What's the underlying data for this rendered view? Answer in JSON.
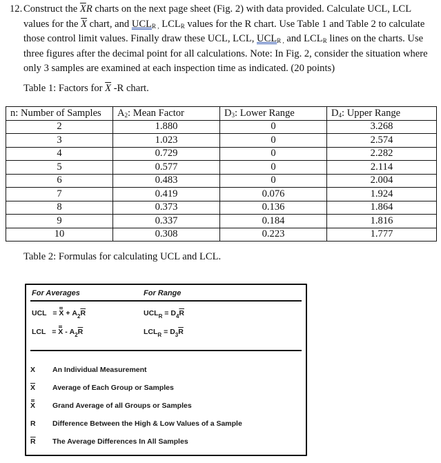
{
  "question": {
    "number": "12.",
    "line1_a": "Construct the ",
    "line1_xbar": "X",
    "line1_r": "R",
    "line1_b": "  charts on the next page sheet (Fig. 2) with data provided. Calculate UCL, LCL",
    "line2_a": "values for the ",
    "line2_xbar": "X",
    "line2_b": " chart, and ",
    "line2_uclr": "UCL",
    "line2_uclr_sub": "R ,",
    "line2_c": " LCL",
    "line2_lclr_sub": "R",
    "line2_d": " values for the R chart. Use Table 1 and Table 2 to calculate",
    "line3_a": "those control limit values. Finally draw these UCL, LCL, ",
    "line3_uclr": "UCL",
    "line3_uclr_sub": "R ,",
    "line3_b": " and LCL",
    "line3_lclr_sub": "R",
    "line3_c": " lines on the charts. Use",
    "line4": "three figures after the decimal point for all calculations. Note: In Fig. 2, consider the situation where",
    "line5": "only 3 samples are examined at each inspection time as indicated.   (20 points)"
  },
  "table1": {
    "caption_a": "Table 1: Factors for ",
    "caption_xbar": "X",
    "caption_b": " -R chart.",
    "headers": [
      {
        "main": "n: Number of Samples",
        "sub": "",
        "rest": ""
      },
      {
        "main": "A",
        "sub": "2",
        "rest": ": Mean Factor"
      },
      {
        "main": "D",
        "sub": "3",
        "rest": ": Lower Range"
      },
      {
        "main": "D",
        "sub": "4",
        "rest": ": Upper Range"
      }
    ],
    "rows": [
      [
        "2",
        "1.880",
        "0",
        "3.268"
      ],
      [
        "3",
        "1.023",
        "0",
        "2.574"
      ],
      [
        "4",
        "0.729",
        "0",
        "2.282"
      ],
      [
        "5",
        "0.577",
        "0",
        "2.114"
      ],
      [
        "6",
        "0.483",
        "0",
        "2.004"
      ],
      [
        "7",
        "0.419",
        "0.076",
        "1.924"
      ],
      [
        "8",
        "0.373",
        "0.136",
        "1.864"
      ],
      [
        "9",
        "0.337",
        "0.184",
        "1.816"
      ],
      [
        "10",
        "0.308",
        "0.223",
        "1.777"
      ]
    ]
  },
  "table2": {
    "caption": "Table 2: Formulas for calculating UCL and LCL.",
    "col_averages": "For Averages",
    "col_range": "For Range",
    "formulas": {
      "ucl_label": "UCL",
      "lcl_label": "LCL",
      "eq": "=",
      "x": "X",
      "plus": "+",
      "minus": "-",
      "a": "A",
      "a_sub": "2",
      "r": "R",
      "uclr_label": "UCL",
      "lclr_label": "LCL",
      "r_sub": "R",
      "d": "D",
      "d4_sub": "4",
      "d3_sub": "3"
    },
    "legend": [
      {
        "symbol": "X",
        "mark": "none",
        "text": "An Individual Measurement"
      },
      {
        "symbol": "X",
        "mark": "bar",
        "text": "Average of Each Group or Samples"
      },
      {
        "symbol": "X",
        "mark": "doublebar",
        "text": "Grand Average of all Groups or Samples"
      },
      {
        "symbol": "R",
        "mark": "none",
        "text": "Difference Between the High & Low Values of a Sample"
      },
      {
        "symbol": "R",
        "mark": "bar",
        "text": "The Average Differences In All Samples"
      }
    ]
  }
}
